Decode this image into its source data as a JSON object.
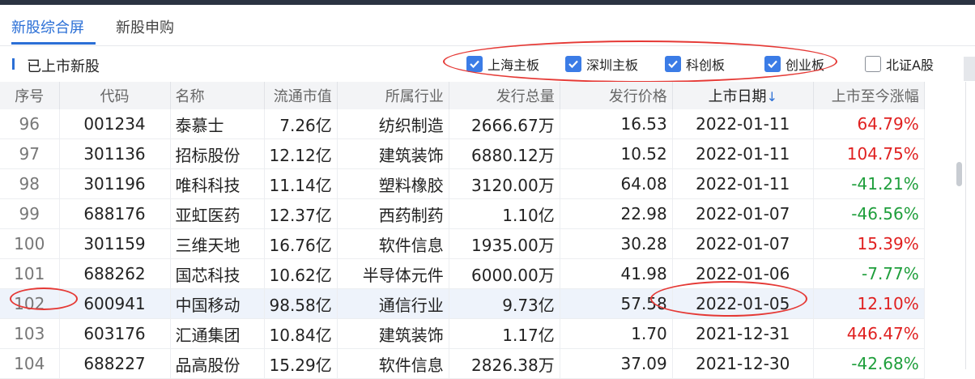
{
  "tabs": [
    {
      "label": "新股综合屏",
      "active": true
    },
    {
      "label": "新股申购",
      "active": false
    }
  ],
  "section_title": "已上市新股",
  "filters": [
    {
      "label": "上海主板",
      "checked": true
    },
    {
      "label": "深圳主板",
      "checked": true
    },
    {
      "label": "科创板",
      "checked": true
    },
    {
      "label": "创业板",
      "checked": true
    },
    {
      "label": "北证A股",
      "checked": false
    }
  ],
  "table": {
    "headers": [
      "序号",
      "代码",
      "名称",
      "流通市值",
      "所属行业",
      "发行总量",
      "发行价格",
      "上市日期",
      "上市至今涨幅"
    ],
    "sort_indicator": "↓",
    "rows": [
      {
        "idx": "96",
        "code": "001234",
        "name": "泰慕士",
        "mcap": "7.26亿",
        "industry": "纺织制造",
        "shares": "2666.67万",
        "price": "16.53",
        "date": "2022-01-11",
        "change": "64.79%",
        "dir": "up"
      },
      {
        "idx": "97",
        "code": "301136",
        "name": "招标股份",
        "mcap": "12.12亿",
        "industry": "建筑装饰",
        "shares": "6880.12万",
        "price": "10.52",
        "date": "2022-01-11",
        "change": "104.75%",
        "dir": "up"
      },
      {
        "idx": "98",
        "code": "301196",
        "name": "唯科科技",
        "mcap": "11.14亿",
        "industry": "塑料橡胶",
        "shares": "3120.00万",
        "price": "64.08",
        "date": "2022-01-11",
        "change": "-41.21%",
        "dir": "down"
      },
      {
        "idx": "99",
        "code": "688176",
        "name": "亚虹医药",
        "mcap": "12.37亿",
        "industry": "西药制药",
        "shares": "1.10亿",
        "price": "22.98",
        "date": "2022-01-07",
        "change": "-46.56%",
        "dir": "down"
      },
      {
        "idx": "100",
        "code": "301159",
        "name": "三维天地",
        "mcap": "16.76亿",
        "industry": "软件信息",
        "shares": "1935.00万",
        "price": "30.28",
        "date": "2022-01-07",
        "change": "15.39%",
        "dir": "up"
      },
      {
        "idx": "101",
        "code": "688262",
        "name": "国芯科技",
        "mcap": "10.62亿",
        "industry": "半导体元件",
        "shares": "6000.00万",
        "price": "41.98",
        "date": "2022-01-06",
        "change": "-7.77%",
        "dir": "down"
      },
      {
        "idx": "102",
        "code": "600941",
        "name": "中国移动",
        "mcap": "98.58亿",
        "industry": "通信行业",
        "shares": "9.73亿",
        "price": "57.58",
        "date": "2022-01-05",
        "change": "12.10%",
        "dir": "up",
        "selected": true
      },
      {
        "idx": "103",
        "code": "603176",
        "name": "汇通集团",
        "mcap": "10.84亿",
        "industry": "建筑装饰",
        "shares": "1.17亿",
        "price": "1.70",
        "date": "2021-12-31",
        "change": "446.47%",
        "dir": "up"
      },
      {
        "idx": "104",
        "code": "688227",
        "name": "品高股份",
        "mcap": "15.29亿",
        "industry": "软件信息",
        "shares": "2826.38万",
        "price": "37.09",
        "date": "2021-12-30",
        "change": "-42.68%",
        "dir": "down"
      }
    ]
  },
  "colors": {
    "accent": "#2b6fd6",
    "up": "#e02020",
    "down": "#1e9e3b",
    "annotation": "#e53935"
  }
}
